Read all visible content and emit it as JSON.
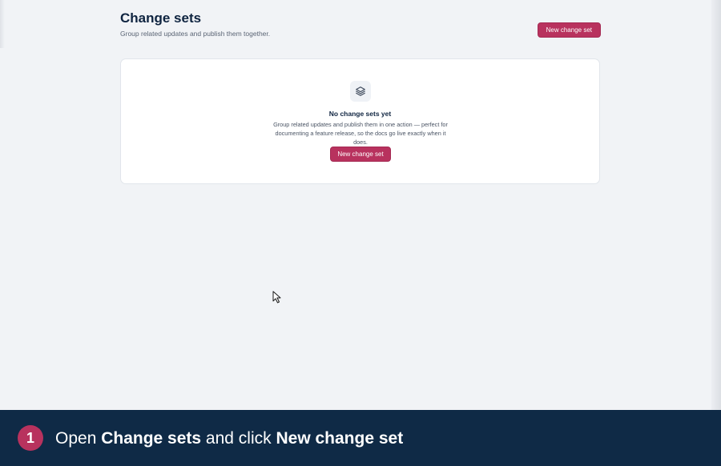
{
  "header": {
    "title": "Change sets",
    "subtitle": "Group related updates and publish them together.",
    "new_button_label": "New change set"
  },
  "empty_state": {
    "icon": "layers-icon",
    "title": "No change sets yet",
    "description": "Group related updates and publish them in one action — perfect for documenting a feature release, so the docs go live exactly when it does.",
    "button_label": "New change set"
  },
  "tutorial": {
    "step_number": "1",
    "text_open": "Open ",
    "text_target": "Change sets",
    "text_middle": " and click ",
    "text_action": "New change set"
  },
  "colors": {
    "accent": "#b8325e",
    "background": "#f1f3f6",
    "footer": "#0f2a46",
    "title": "#0f2440"
  }
}
